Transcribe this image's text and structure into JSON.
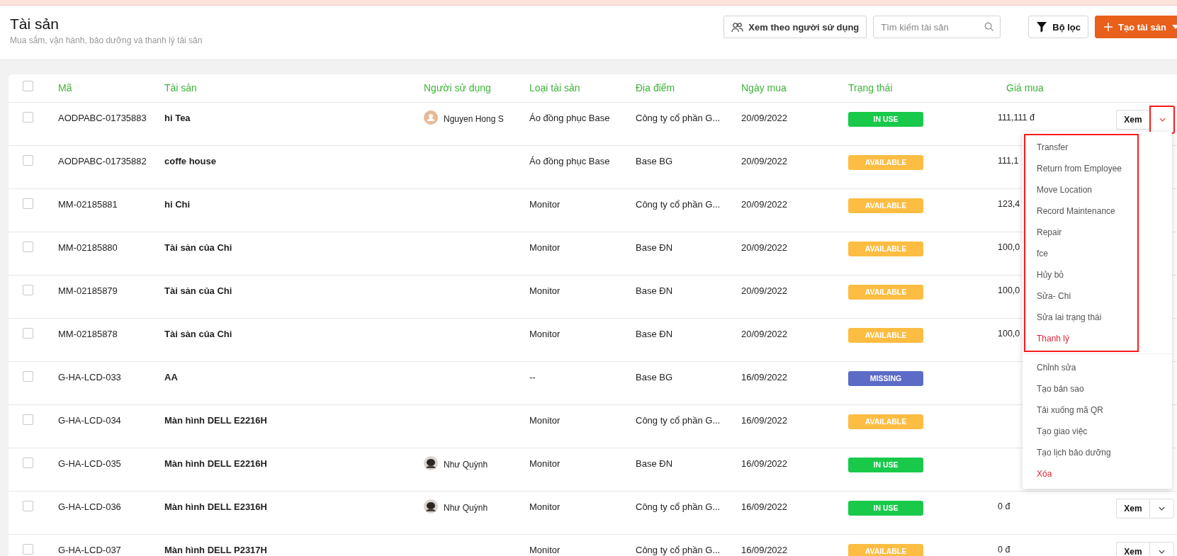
{
  "header": {
    "title": "Tài sản",
    "subtitle": "Mua sắm, vận hành, bảo dưỡng và thanh lý tải sản",
    "view_by_user": "Xem theo người sử dụng",
    "search": {
      "placeholder": "Tìm kiếm tài sản"
    },
    "filter": "Bộ lọc",
    "create": "Tạo tài sản"
  },
  "table": {
    "select_all": {
      "checked": false
    },
    "columns": [
      "Mã",
      "Tài sản",
      "Người sử dụng",
      "Loại tài sản",
      "Địa điểm",
      "Ngày mua",
      "Trạng thái",
      "Giá mua"
    ],
    "rows": [
      {
        "checked": false,
        "code": "AODPABC-01735883",
        "name": "hi Tea",
        "user": {
          "name": "Nguyen Hong S",
          "kind": "placeholder"
        },
        "type": "Áo đồng phục Base",
        "location": "Công ty cổ phần G...",
        "date": "20/09/2022",
        "status": {
          "label": "IN USE",
          "kind": "in_use"
        },
        "price": "111,111 đ",
        "actions": {
          "label": "Xem",
          "menu_open": true,
          "highlighted": true
        }
      },
      {
        "checked": false,
        "code": "AODPABC-01735882",
        "name": "coffe house",
        "type": "Áo đồng phục Base",
        "location": "Base BG",
        "date": "20/09/2022",
        "status": {
          "label": "AVAILABLE",
          "kind": "available"
        },
        "price": "111,1"
      },
      {
        "checked": false,
        "code": "MM-02185881",
        "name": "hi Chi",
        "type": "Monitor",
        "location": "Công ty cổ phần G...",
        "date": "20/09/2022",
        "status": {
          "label": "AVAILABLE",
          "kind": "available"
        },
        "price": "123,4"
      },
      {
        "checked": false,
        "code": "MM-02185880",
        "name": "Tài sản của Chi",
        "type": "Monitor",
        "location": "Base ĐN",
        "date": "20/09/2022",
        "status": {
          "label": "AVAILABLE",
          "kind": "available"
        },
        "price": "100,0"
      },
      {
        "checked": false,
        "code": "MM-02185879",
        "name": "Tài sản của Chi",
        "type": "Monitor",
        "location": "Base ĐN",
        "date": "20/09/2022",
        "status": {
          "label": "AVAILABLE",
          "kind": "available"
        },
        "price": "100,0"
      },
      {
        "checked": false,
        "code": "MM-02185878",
        "name": "Tài sản của Chi",
        "type": "Monitor",
        "location": "Base ĐN",
        "date": "20/09/2022",
        "status": {
          "label": "AVAILABLE",
          "kind": "available"
        },
        "price": "100,0"
      },
      {
        "checked": false,
        "code": "G-HA-LCD-033",
        "name": "AA",
        "type": "--",
        "location": "Base BG",
        "date": "16/09/2022",
        "status": {
          "label": "MISSING",
          "kind": "missing"
        }
      },
      {
        "checked": false,
        "code": "G-HA-LCD-034",
        "name": "Màn hình DELL E2216H",
        "type": "Monitor",
        "location": "Công ty cổ phần G...",
        "date": "16/09/2022",
        "status": {
          "label": "AVAILABLE",
          "kind": "available"
        }
      },
      {
        "checked": false,
        "code": "G-HA-LCD-035",
        "name": "Màn hình DELL E2216H",
        "user": {
          "name": "Như Quỳnh",
          "kind": "photo"
        },
        "type": "Monitor",
        "location": "Base ĐN",
        "date": "16/09/2022",
        "status": {
          "label": "IN USE",
          "kind": "in_use"
        }
      },
      {
        "checked": false,
        "code": "G-HA-LCD-036",
        "name": "Màn hình DELL E2316H",
        "user": {
          "name": "Như Quỳnh",
          "kind": "photo"
        },
        "type": "Monitor",
        "location": "Công ty cổ phần G...",
        "date": "16/09/2022",
        "status": {
          "label": "IN USE",
          "kind": "in_use"
        },
        "price": "0 đ",
        "actions": {
          "label": "Xem",
          "menu_open": false
        }
      },
      {
        "checked": false,
        "code": "G-HA-LCD-037",
        "name": "Màn hình DELL P2317H",
        "type": "Monitor",
        "location": "Công ty cổ phần G...",
        "date": "16/09/2022",
        "status": {
          "label": "AVAILABLE",
          "kind": "available"
        },
        "price": "0 đ",
        "actions": {
          "label": "Xem",
          "menu_open": false
        }
      }
    ]
  },
  "menu": {
    "sections": [
      {
        "highlighted": true,
        "items": [
          {
            "label": "Transfer",
            "kind": "normal"
          },
          {
            "label": "Return from Employee",
            "kind": "normal"
          },
          {
            "label": "Move Location",
            "kind": "normal"
          },
          {
            "label": "Record Maintenance",
            "kind": "normal"
          },
          {
            "label": "Repair",
            "kind": "normal"
          },
          {
            "label": "fce",
            "kind": "normal"
          },
          {
            "label": "Hủy bỏ",
            "kind": "normal"
          },
          {
            "label": "Sửa- Chi",
            "kind": "normal"
          },
          {
            "label": "Sửa lai trạng thái",
            "kind": "normal"
          },
          {
            "label": "Thanh lý",
            "kind": "danger"
          }
        ]
      },
      {
        "highlighted": false,
        "items": [
          {
            "label": "Chỉnh sửa",
            "kind": "normal"
          },
          {
            "label": "Tạo bản sao",
            "kind": "normal"
          },
          {
            "label": "Tải xuống mã QR",
            "kind": "normal"
          },
          {
            "label": "Tạo giao việc",
            "kind": "normal"
          },
          {
            "label": "Tạo lịch bảo dưỡng",
            "kind": "normal"
          },
          {
            "label": "Xóa",
            "kind": "danger"
          }
        ]
      }
    ]
  }
}
